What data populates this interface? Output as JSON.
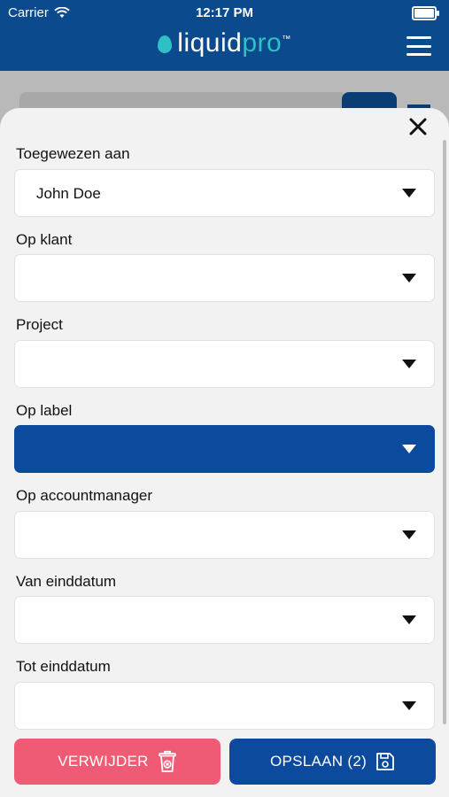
{
  "status_bar": {
    "carrier": "Carrier",
    "time": "12:17 PM"
  },
  "header": {
    "brand_left": "liquid",
    "brand_right": "pro",
    "brand_tm": "™"
  },
  "form": {
    "fields": [
      {
        "label": "Toegewezen aan",
        "value": "John Doe"
      },
      {
        "label": "Op klant",
        "value": ""
      },
      {
        "label": "Project",
        "value": ""
      },
      {
        "label": "Op label",
        "value": ""
      },
      {
        "label": "Op accountmanager",
        "value": ""
      },
      {
        "label": "Van einddatum",
        "value": ""
      },
      {
        "label": "Tot einddatum",
        "value": ""
      }
    ]
  },
  "actions": {
    "delete_label": "VERWIJDER",
    "save_label": "OPSLAAN (2)"
  },
  "colors": {
    "primary": "#0b4a9c",
    "header": "#0b4a8c",
    "accent": "#2ec0c7",
    "danger": "#ef5b74",
    "sheet_bg": "#f2f2f2"
  },
  "icons": {
    "close": "close-icon",
    "menu": "hamburger-menu-icon",
    "delete": "trash-icon",
    "save": "floppy-disk-icon",
    "caret": "triangle-down-icon"
  }
}
